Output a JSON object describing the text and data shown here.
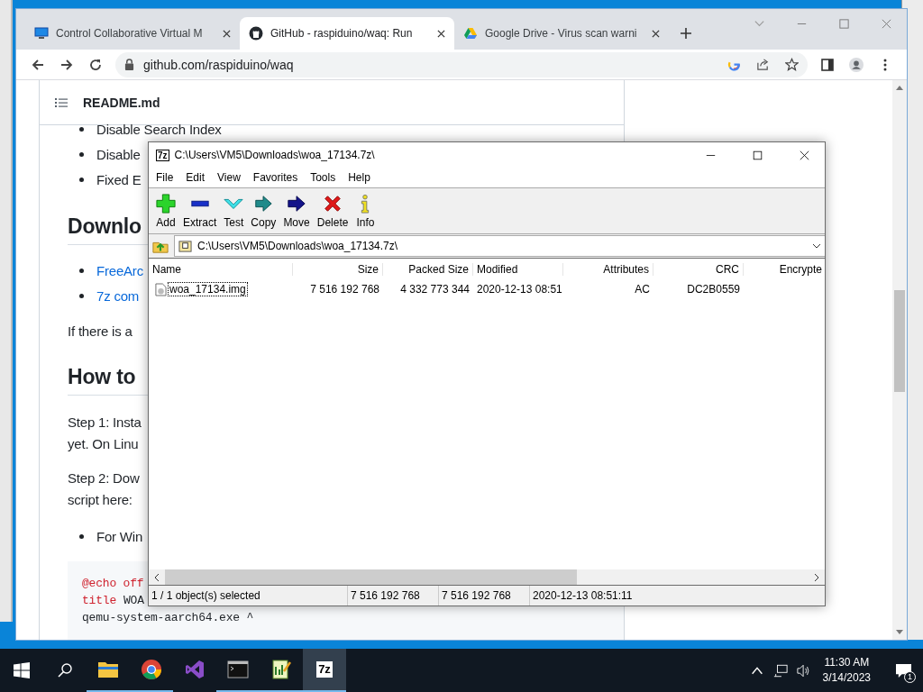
{
  "browser": {
    "tabs": [
      {
        "title": "Control Collaborative Virtual M",
        "selected": false
      },
      {
        "title": "GitHub - raspiduino/waq: Run",
        "selected": true
      },
      {
        "title": "Google Drive - Virus scan warni",
        "selected": false
      }
    ],
    "url": "github.com/raspiduino/waq",
    "readme": {
      "title": "README.md",
      "blocks": [
        {
          "kind": "bullet",
          "text": "Disable Search Index"
        },
        {
          "kind": "bullet",
          "text": "Disable"
        },
        {
          "kind": "bullet",
          "text": "Fixed E"
        },
        {
          "kind": "heading",
          "text": "Downlo"
        },
        {
          "kind": "link",
          "text": "FreeArc"
        },
        {
          "kind": "link",
          "text": "7z com"
        },
        {
          "kind": "paragraph",
          "lines": [
            "If there is a"
          ]
        },
        {
          "kind": "heading",
          "text": "How to"
        },
        {
          "kind": "paragraph",
          "lines": [
            "Step 1: Insta",
            "yet. On Linu"
          ]
        },
        {
          "kind": "paragraph",
          "lines": [
            "Step 2: Dow",
            "script here:"
          ]
        },
        {
          "kind": "bullet",
          "text": "For Win"
        },
        {
          "kind": "code",
          "lines": [
            [
              {
                "kind": "keyword",
                "text": "@echo off"
              }
            ],
            [
              {
                "kind": "keyword",
                "text": "title"
              },
              {
                "kind": "plain",
                "text": "WOA"
              }
            ],
            [
              {
                "kind": "plain",
                "text": "qemu-system-aarch64.exe ^"
              }
            ]
          ]
        }
      ]
    }
  },
  "archive_window": {
    "icon_text": "7z",
    "title": "C:\\Users\\VM5\\Downloads\\woa_17134.7z\\",
    "menu": [
      "File",
      "Edit",
      "View",
      "Favorites",
      "Tools",
      "Help"
    ],
    "toolbar": [
      {
        "kind": "add",
        "label": "Add"
      },
      {
        "kind": "extract",
        "label": "Extract"
      },
      {
        "kind": "test",
        "label": "Test"
      },
      {
        "kind": "copy",
        "label": "Copy"
      },
      {
        "kind": "move",
        "label": "Move"
      },
      {
        "kind": "delete",
        "label": "Delete"
      },
      {
        "kind": "info",
        "label": "Info"
      }
    ],
    "path": "C:\\Users\\VM5\\Downloads\\woa_17134.7z\\",
    "columns": [
      "Name",
      "Size",
      "Packed Size",
      "Modified",
      "Attributes",
      "CRC",
      "Encrypte"
    ],
    "rows": [
      {
        "selected": true,
        "cells": [
          "woa_17134.img",
          "7 516 192 768",
          "4 332 773 344",
          "2020-12-13 08:51",
          "AC",
          "DC2B0559"
        ]
      }
    ],
    "status": [
      "1 / 1 object(s) selected",
      "7 516 192 768",
      "7 516 192 768",
      "2020-12-13 08:51:11"
    ]
  },
  "taskbar": {
    "apps": [
      {
        "kind": "explorer",
        "running": true,
        "selected": false
      },
      {
        "kind": "chrome",
        "running": true,
        "selected": false
      },
      {
        "kind": "studio",
        "running": false,
        "selected": false
      },
      {
        "kind": "terminal",
        "running": true,
        "selected": false
      },
      {
        "kind": "notepad",
        "running": true,
        "selected": false
      },
      {
        "kind": "archiver",
        "label": "7z",
        "running": true,
        "selected": true
      }
    ],
    "time": "11:30 AM",
    "date": "3/14/2023",
    "notifications": "1"
  }
}
